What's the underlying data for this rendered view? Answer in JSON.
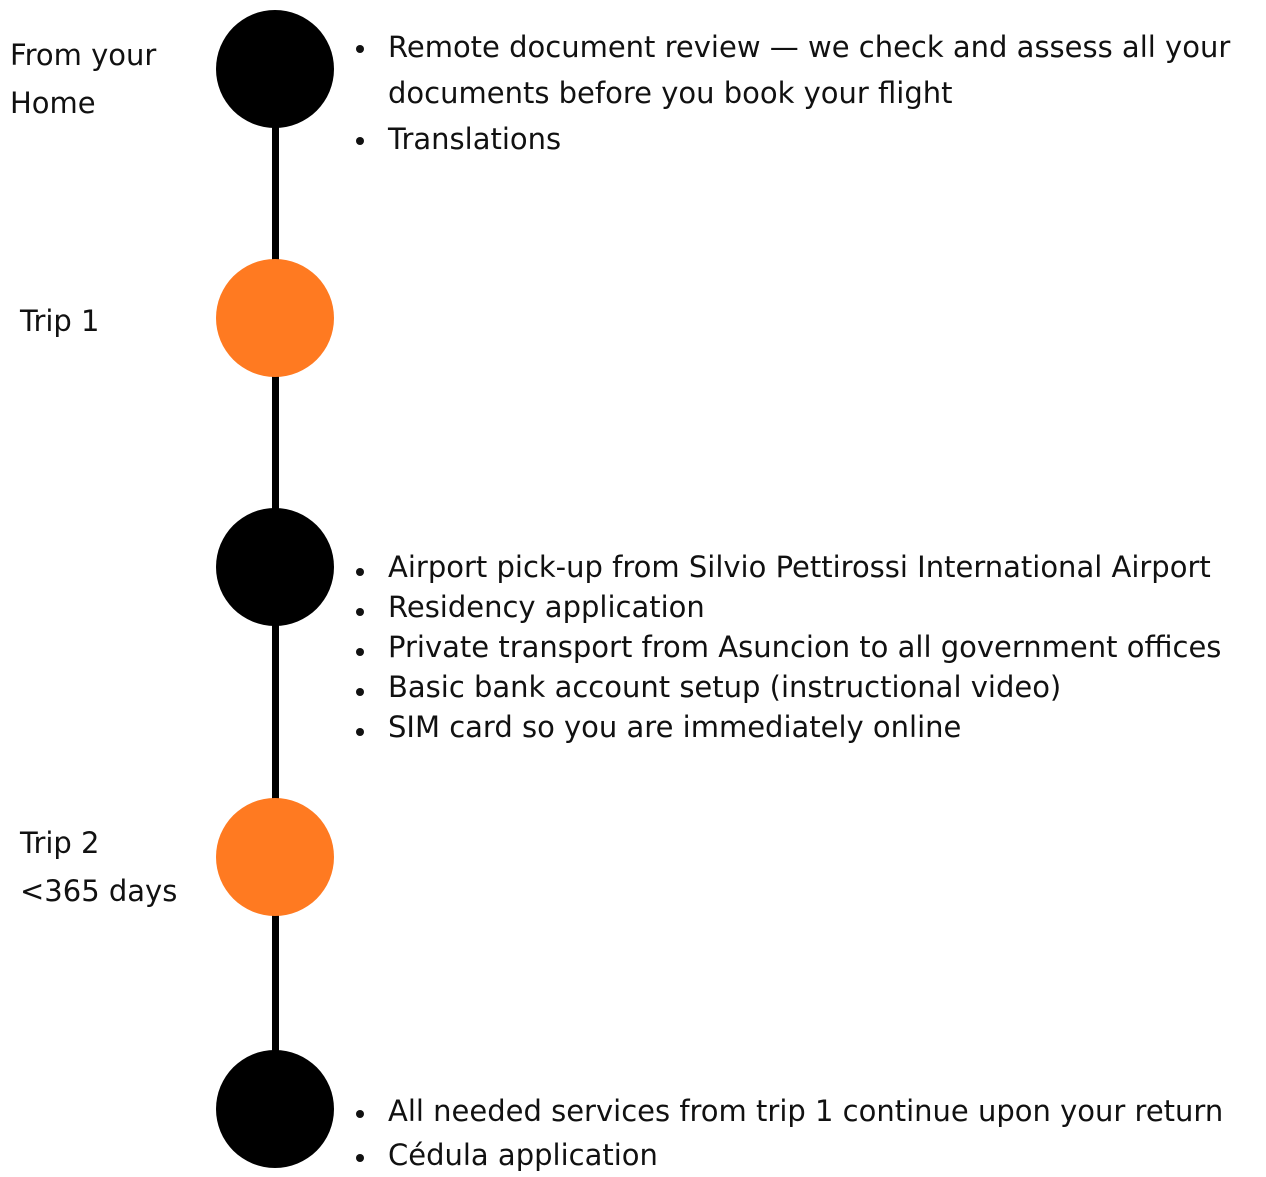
{
  "colors": {
    "black_node": "#000000",
    "orange_node": "#FF7A21",
    "line": "#000000"
  },
  "labels": {
    "home_line1": "From your",
    "home_line2": "Home",
    "trip1": "Trip 1",
    "trip2_line1": "Trip 2",
    "trip2_line2": "<365 days"
  },
  "home_services": [
    "Remote document review — we check and assess all your",
    "documents before you book your flight",
    "Translations"
  ],
  "trip1_services": [
    "Airport pick-up from Silvio Pettirossi International Airport",
    "Residency application",
    "Private transport from Asuncion to all government offices",
    "Basic bank account setup (instructional video)",
    "SIM card so you are immediately online"
  ],
  "trip2_services": [
    "All needed services from trip 1 continue upon your return",
    "Cédula application"
  ]
}
